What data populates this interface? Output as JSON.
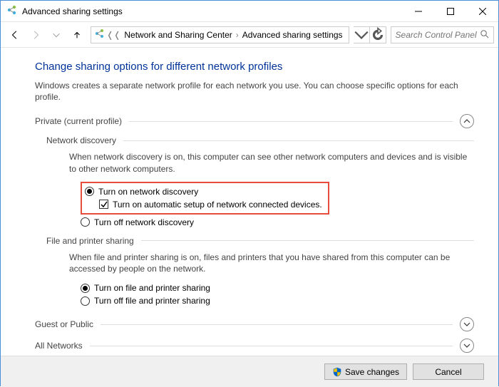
{
  "titlebar": {
    "title": "Advanced sharing settings"
  },
  "breadcrumb": {
    "item0": "Network and Sharing Center",
    "item1": "Advanced sharing settings"
  },
  "search": {
    "placeholder": "Search Control Panel"
  },
  "page": {
    "heading": "Change sharing options for different network profiles",
    "desc": "Windows creates a separate network profile for each network you use. You can choose specific options for each profile."
  },
  "section_private": {
    "title": "Private (current profile)",
    "network_discovery": {
      "title": "Network discovery",
      "desc": "When network discovery is on, this computer can see other network computers and devices and is visible to other network computers.",
      "opt_on": "Turn on network discovery",
      "opt_auto": "Turn on automatic setup of network connected devices.",
      "opt_off": "Turn off network discovery"
    },
    "file_printer": {
      "title": "File and printer sharing",
      "desc": "When file and printer sharing is on, files and printers that you have shared from this computer can be accessed by people on the network.",
      "opt_on": "Turn on file and printer sharing",
      "opt_off": "Turn off file and printer sharing"
    }
  },
  "section_guest": {
    "title": "Guest or Public"
  },
  "section_all": {
    "title": "All Networks"
  },
  "footer": {
    "save": "Save changes",
    "cancel": "Cancel"
  }
}
